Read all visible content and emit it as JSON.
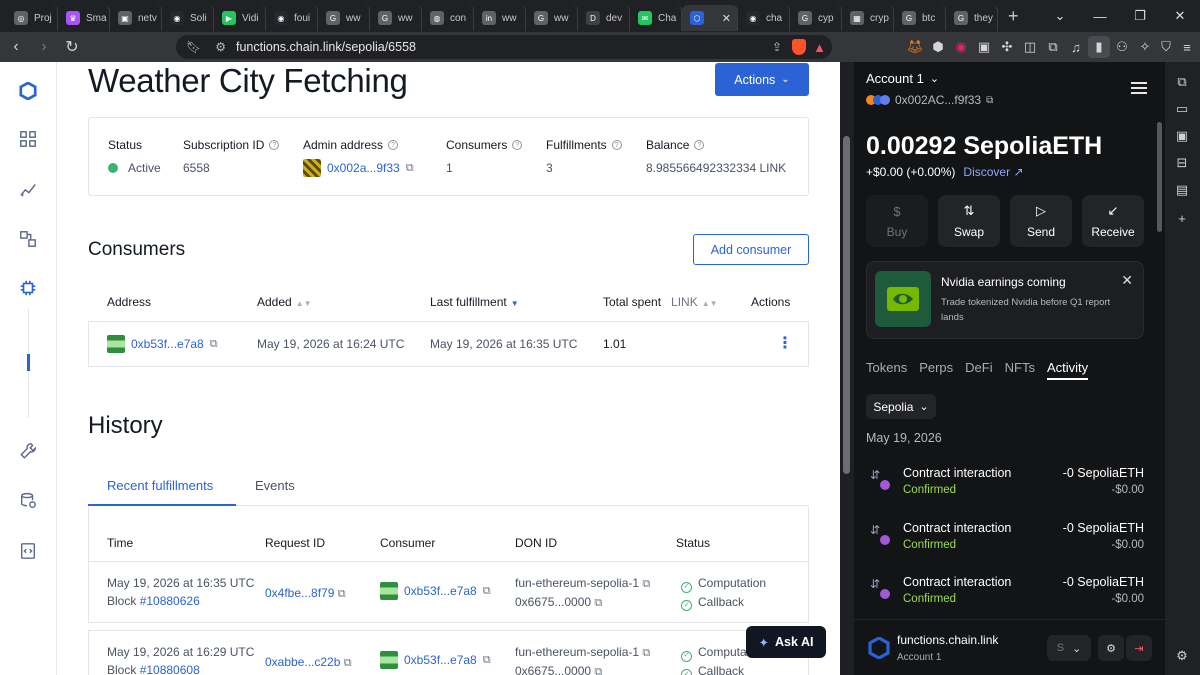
{
  "browser": {
    "tabs": [
      {
        "label": "Proj",
        "color": "#5f6368",
        "glyph": "◎"
      },
      {
        "label": "Sma",
        "color": "#a855f7",
        "glyph": "♛"
      },
      {
        "label": "netv",
        "color": "#5f6368",
        "glyph": "▣"
      },
      {
        "label": "Soli",
        "color": "#24292f",
        "glyph": "◉"
      },
      {
        "label": "Vidi",
        "color": "#22c55e",
        "glyph": "▶"
      },
      {
        "label": "foui",
        "color": "#24292f",
        "glyph": "◉"
      },
      {
        "label": "ww",
        "color": "#5f6368",
        "glyph": "G"
      },
      {
        "label": "ww",
        "color": "#5f6368",
        "glyph": "G"
      },
      {
        "label": "con",
        "color": "#5f6368",
        "glyph": "◍"
      },
      {
        "label": "ww",
        "color": "#5f6368",
        "glyph": "in"
      },
      {
        "label": "ww",
        "color": "#5f6368",
        "glyph": "G"
      },
      {
        "label": "dev",
        "color": "#3f3f46",
        "glyph": "D"
      },
      {
        "label": "Cha",
        "color": "#22c55e",
        "glyph": "✉"
      },
      {
        "label": "",
        "color": "#2b63d6",
        "glyph": "⬡"
      },
      {
        "label": "cha",
        "color": "#24292f",
        "glyph": "◉"
      },
      {
        "label": "cyp",
        "color": "#5f6368",
        "glyph": "G"
      },
      {
        "label": "cryp",
        "color": "#5f6368",
        "glyph": "▦"
      },
      {
        "label": "btc",
        "color": "#5f6368",
        "glyph": "G"
      },
      {
        "label": "they",
        "color": "#5f6368",
        "glyph": "G"
      }
    ],
    "url": "functions.chain.link/sepolia/6558"
  },
  "page": {
    "title": "Weather City Fetching",
    "actions_label": "Actions",
    "info": {
      "status_label": "Status",
      "status_value": "Active",
      "subscription_label": "Subscription ID",
      "subscription_value": "6558",
      "admin_label": "Admin address",
      "admin_value": "0x002a...9f33",
      "consumers_label": "Consumers",
      "consumers_value": "1",
      "fulfillments_label": "Fulfillments",
      "fulfillments_value": "3",
      "balance_label": "Balance",
      "balance_value": "8.985566492332334 LINK"
    },
    "consumers": {
      "heading": "Consumers",
      "add_label": "Add consumer",
      "columns": {
        "address": "Address",
        "added": "Added",
        "last": "Last fulfillment",
        "spent": "Total spent",
        "spent_unit": "LINK",
        "actions": "Actions"
      },
      "rows": [
        {
          "address": "0xb53f...e7a8",
          "added": "May 19, 2026 at 16:24 UTC",
          "last": "May 19, 2026 at 16:35 UTC",
          "spent": "1.01"
        }
      ]
    },
    "history": {
      "heading": "History",
      "tab_recent": "Recent fulfillments",
      "tab_events": "Events",
      "columns": {
        "time": "Time",
        "request": "Request ID",
        "consumer": "Consumer",
        "don": "DON ID",
        "status": "Status"
      },
      "rows": [
        {
          "time": "May 19, 2026 at 16:35 UTC",
          "block_label": "Block",
          "block": "#10880626",
          "request": "0x4fbe...8f79",
          "consumer": "0xb53f...e7a8",
          "don": "fun-ethereum-sepolia-1",
          "don_hash": "0x6675...0000",
          "status1": "Computation",
          "status2": "Callback"
        },
        {
          "time": "May 19, 2026 at 16:29 UTC",
          "block_label": "Block",
          "block": "#10880608",
          "request": "0xabbe...c22b",
          "consumer": "0xb53f...e7a8",
          "don": "fun-ethereum-sepolia-1",
          "don_hash": "0x6675...0000",
          "status1": "Computation",
          "status2": "Callback"
        }
      ]
    },
    "ask_ai": "Ask AI"
  },
  "wallet": {
    "account": "Account 1",
    "address": "0x002AC...f9f33",
    "balance": "0.00292 SepoliaETH",
    "change": "+$0.00 (+0.00%)",
    "discover": "Discover",
    "actions": [
      {
        "label": "Buy",
        "icon": "$"
      },
      {
        "label": "Swap",
        "icon": "⇅"
      },
      {
        "label": "Send",
        "icon": "▷"
      },
      {
        "label": "Receive",
        "icon": "↙"
      }
    ],
    "promo_title": "Nvidia earnings coming",
    "promo_body": "Trade tokenized Nvidia before Q1 report lands",
    "tabs": [
      "Tokens",
      "Perps",
      "DeFi",
      "NFTs",
      "Activity"
    ],
    "network": "Sepolia",
    "date": "May 19, 2026",
    "transactions": [
      {
        "name": "Contract interaction",
        "status": "Confirmed",
        "amount": "-0 SepoliaETH",
        "usd": "-$0.00"
      },
      {
        "name": "Contract interaction",
        "status": "Confirmed",
        "amount": "-0 SepoliaETH",
        "usd": "-$0.00"
      },
      {
        "name": "Contract interaction",
        "status": "Confirmed",
        "amount": "-0 SepoliaETH",
        "usd": "-$0.00"
      }
    ],
    "footer_site": "functions.chain.link",
    "footer_account": "Account 1",
    "footer_select": "S"
  },
  "colors": {
    "accent": "#2b63d6",
    "active": "#3bb273",
    "wallet_bg": "#131416",
    "confirmed": "#9bdc52"
  }
}
